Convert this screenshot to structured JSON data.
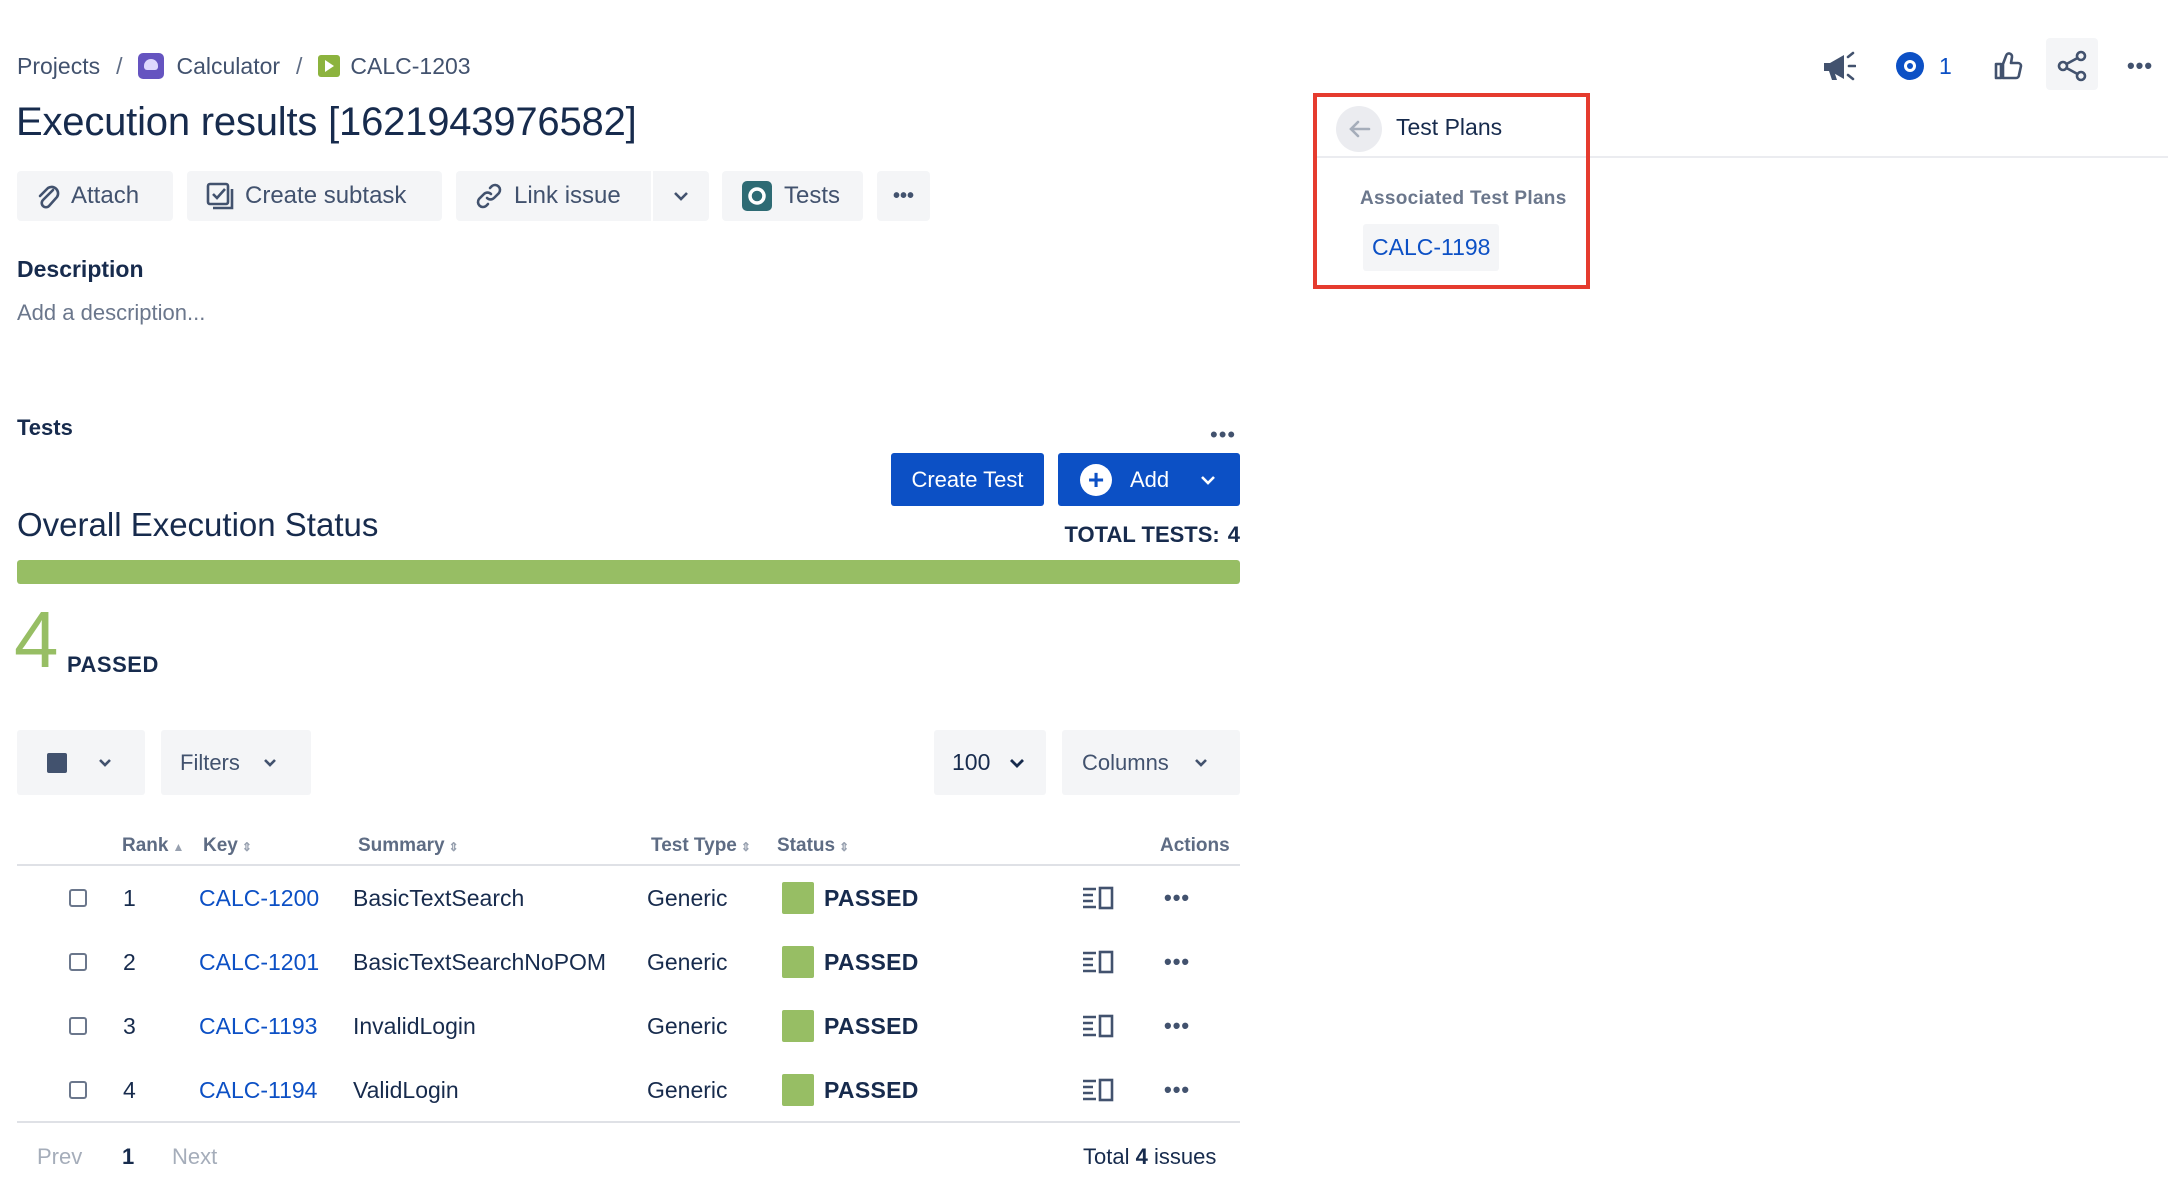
{
  "breadcrumb": {
    "projects": "Projects",
    "separator": "/",
    "project": "Calculator",
    "issue": "CALC-1203"
  },
  "issue": {
    "title": "Execution results [1621943976582]"
  },
  "toolbar": {
    "attach": "Attach",
    "create_subtask": "Create subtask",
    "link_issue": "Link issue",
    "tests": "Tests",
    "more": "•••"
  },
  "description": {
    "heading": "Description",
    "placeholder": "Add a description..."
  },
  "tests_section": {
    "heading": "Tests",
    "more": "•••",
    "create_test": "Create Test",
    "add": "Add",
    "overall_title": "Overall Execution Status",
    "total_label": "TOTAL TESTS:",
    "total_value": "4",
    "progress_passed_fraction": 1.0,
    "passed_count": "4",
    "passed_label": "PASSED",
    "filters_label": "Filters",
    "page_size": "100",
    "columns_label": "Columns"
  },
  "table": {
    "headers": {
      "rank": "Rank",
      "key": "Key",
      "summary": "Summary",
      "test_type": "Test Type",
      "status": "Status",
      "actions": "Actions"
    },
    "rows": [
      {
        "rank": "1",
        "key": "CALC-1200",
        "summary": "BasicTextSearch",
        "test_type": "Generic",
        "status": "PASSED"
      },
      {
        "rank": "2",
        "key": "CALC-1201",
        "summary": "BasicTextSearchNoPOM",
        "test_type": "Generic",
        "status": "PASSED"
      },
      {
        "rank": "3",
        "key": "CALC-1193",
        "summary": "InvalidLogin",
        "test_type": "Generic",
        "status": "PASSED"
      },
      {
        "rank": "4",
        "key": "CALC-1194",
        "summary": "ValidLogin",
        "test_type": "Generic",
        "status": "PASSED"
      }
    ],
    "row_more": "•••"
  },
  "pagination": {
    "prev": "Prev",
    "current": "1",
    "next": "Next",
    "total_prefix": "Total",
    "total_count": "4",
    "total_suffix": "issues"
  },
  "test_plans_panel": {
    "title": "Test Plans",
    "associated_label": "Associated Test Plans",
    "plans": [
      "CALC-1198"
    ]
  },
  "header_actions": {
    "watch_count": "1",
    "more": "•••"
  },
  "colors": {
    "primary": "#0C50C5",
    "passed": "#97BE64",
    "highlight_border": "#E53B2E",
    "text": "#172B4D"
  }
}
